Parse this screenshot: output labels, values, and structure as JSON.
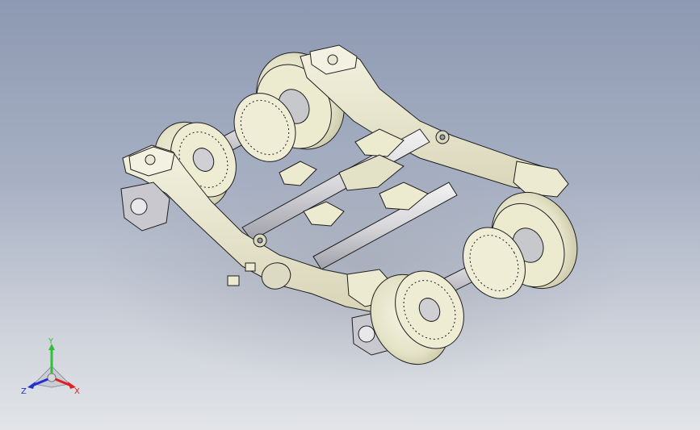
{
  "viewport": {
    "content": "bogie-assembly-isometric",
    "background_top": "#8d99b2",
    "background_bottom": "#e2e4e8",
    "model_color": "#ecebd5",
    "model_edge_color": "#1f1f1f"
  },
  "triad": {
    "y_label": "Y",
    "x_label": "X",
    "z_label": "Z",
    "y_color": "#2fbf3a",
    "x_color": "#e02020",
    "z_color": "#2030d0"
  }
}
